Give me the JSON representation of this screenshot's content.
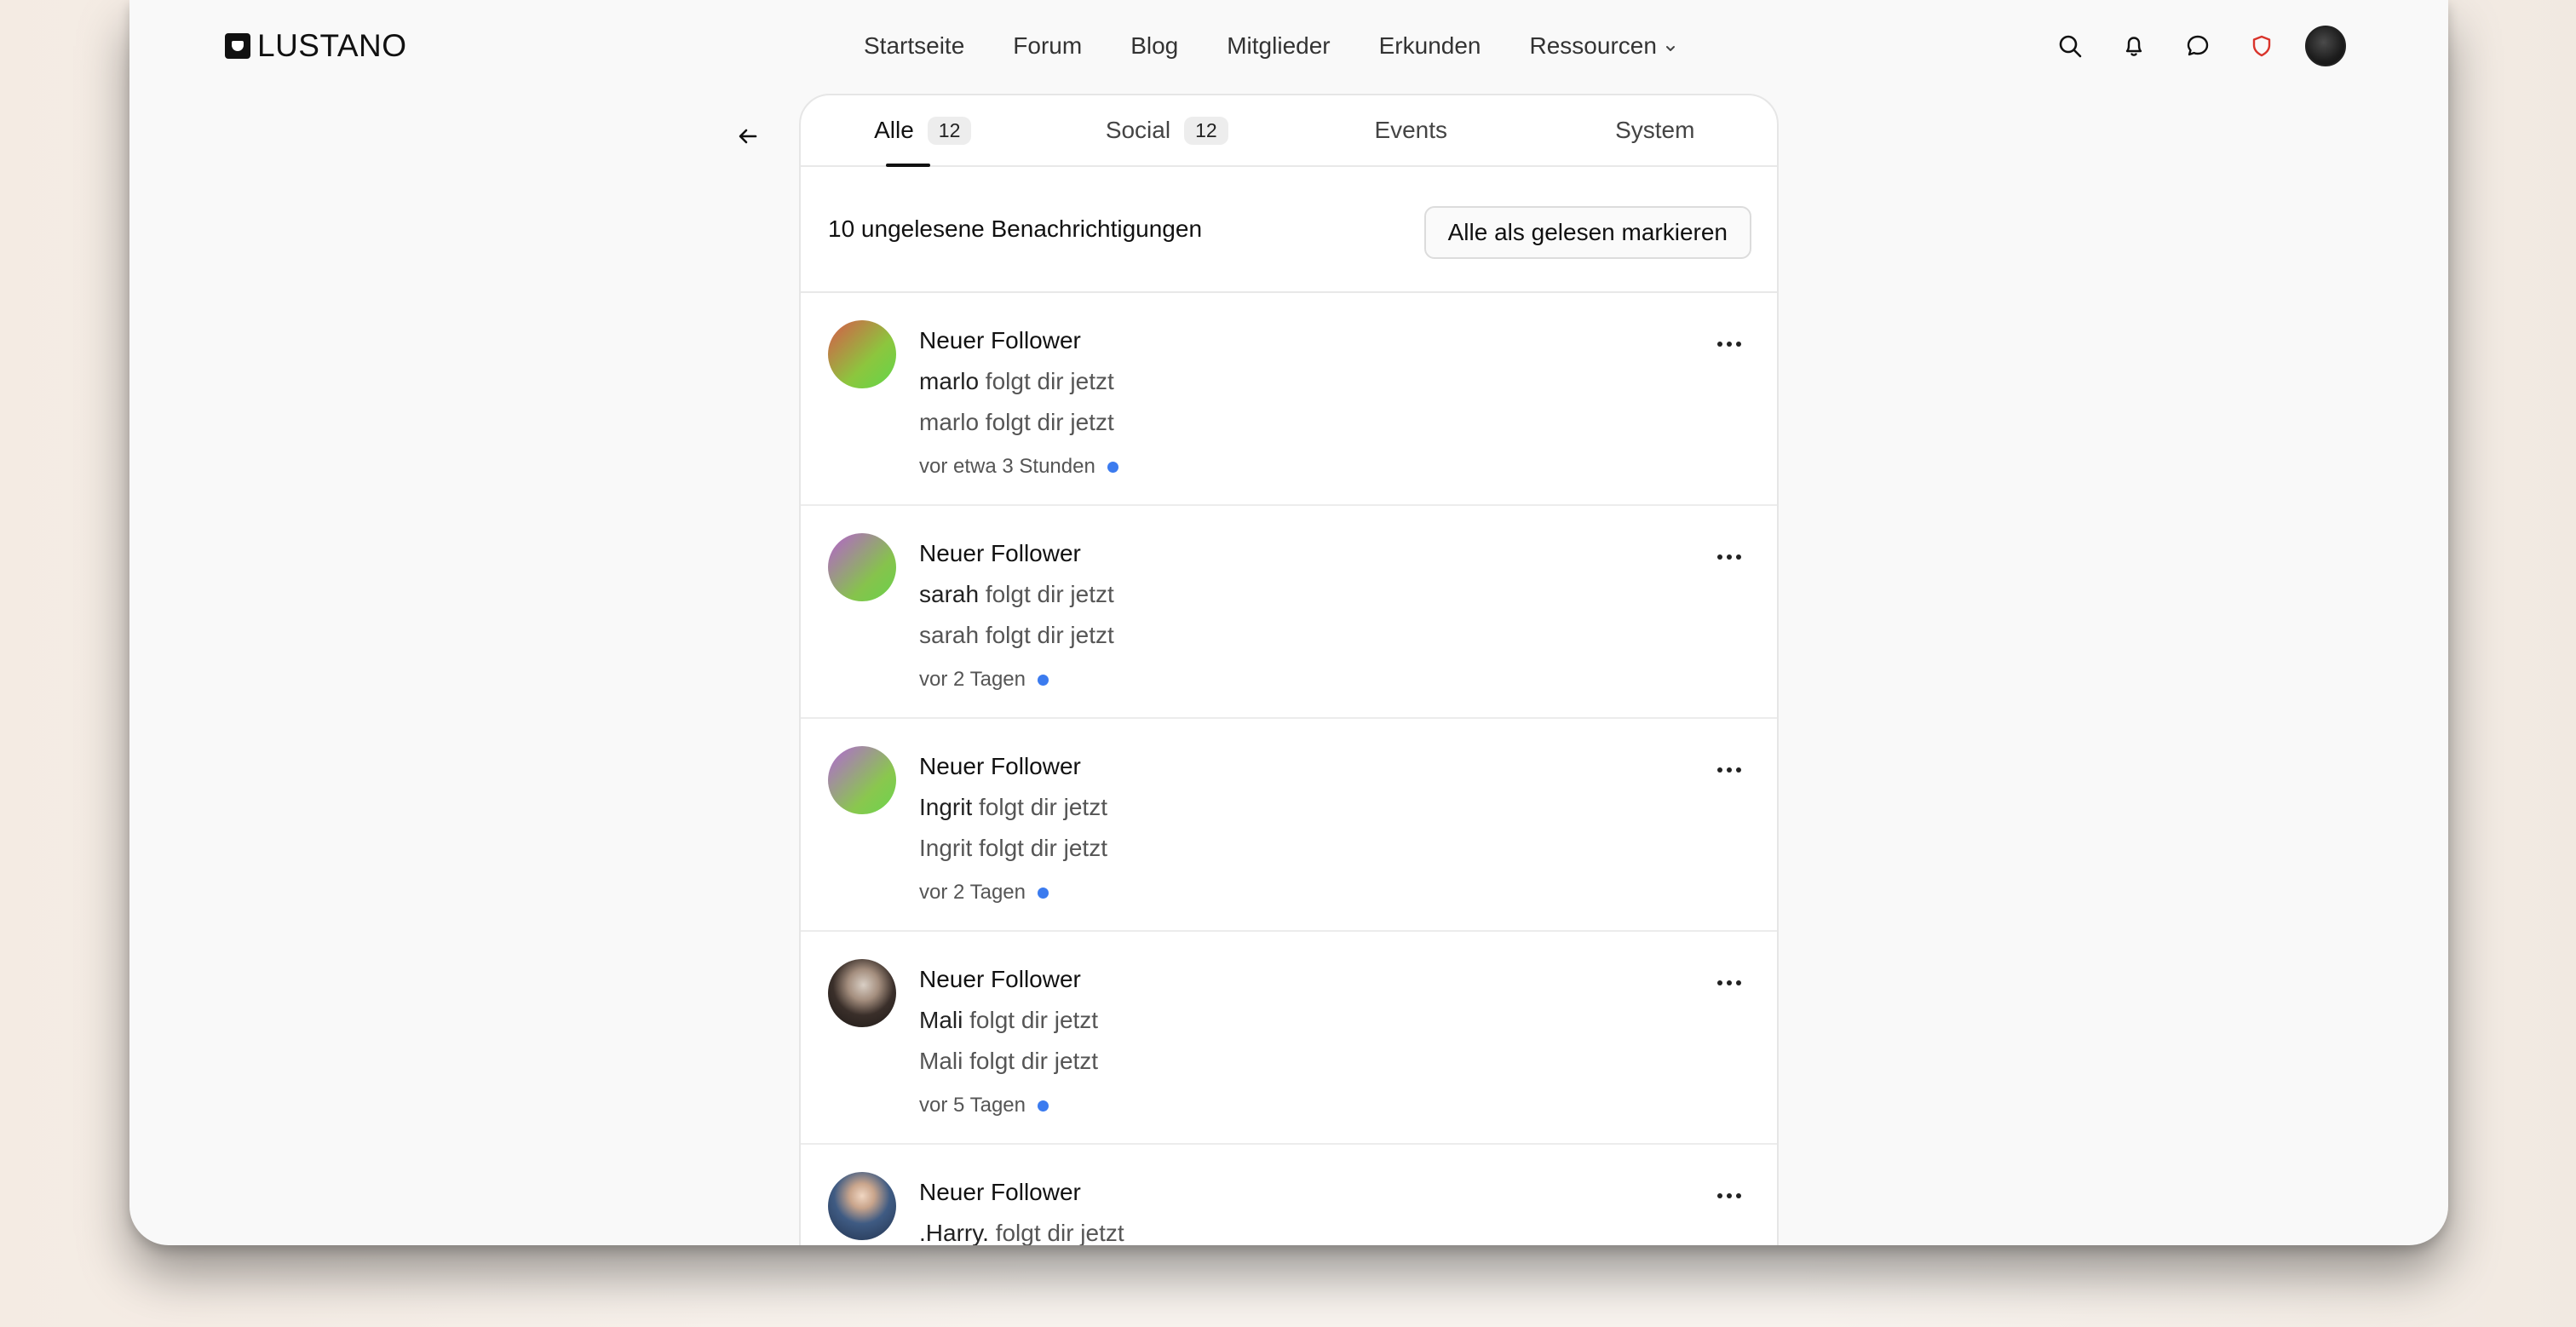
{
  "header": {
    "logo": "LUSTANO",
    "nav": [
      "Startseite",
      "Forum",
      "Blog",
      "Mitglieder",
      "Erkunden",
      "Ressourcen"
    ],
    "icons": [
      "search-icon",
      "bell-icon",
      "chat-icon",
      "shield-icon",
      "user-avatar"
    ],
    "accent_shield_color": "#d9342b"
  },
  "tabs": [
    {
      "label": "Alle",
      "count": "12"
    },
    {
      "label": "Social",
      "count": "12"
    },
    {
      "label": "Events"
    },
    {
      "label": "System"
    }
  ],
  "unread": {
    "text": "10 ungelesene Benachrichtigungen",
    "button": "Alle als gelesen markieren"
  },
  "notifications": [
    {
      "title": "Neuer Follower",
      "user": "marlo",
      "action": "folgt dir jetzt",
      "detail": "marlo folgt dir jetzt",
      "time": "vor etwa 3 Stunden"
    },
    {
      "title": "Neuer Follower",
      "user": "sarah",
      "action": "folgt dir jetzt",
      "detail": "sarah folgt dir jetzt",
      "time": "vor 2 Tagen"
    },
    {
      "title": "Neuer Follower",
      "user": "Ingrit",
      "action": "folgt dir jetzt",
      "detail": "Ingrit folgt dir jetzt",
      "time": "vor 2 Tagen"
    },
    {
      "title": "Neuer Follower",
      "user": "Mali",
      "action": "folgt dir jetzt",
      "detail": "Mali folgt dir jetzt",
      "time": "vor 5 Tagen"
    },
    {
      "title": "Neuer Follower",
      "user": ".Harry.",
      "action": "folgt dir jetzt",
      "detail": "",
      "time": ""
    }
  ],
  "unread_dot_color": "#3b7bef"
}
